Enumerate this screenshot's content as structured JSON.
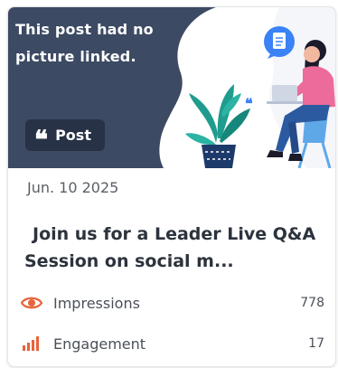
{
  "hero": {
    "message": "This post had no picture linked.",
    "badge_label": "Post",
    "badge_icon": "quote-icon"
  },
  "post": {
    "date": "Jun. 10 2025",
    "title": "Join us for a Leader Live Q&A Session on social m..."
  },
  "metrics": [
    {
      "label": "Impressions",
      "value": "778",
      "icon": "eye-icon",
      "color": "#e8633a"
    },
    {
      "label": "Engagement",
      "value": "17",
      "icon": "bar-chart-icon",
      "color": "#e8633a"
    }
  ],
  "colors": {
    "hero_bg": "#3d4a63",
    "badge_bg": "#283246",
    "accent": "#e8633a",
    "illustration_blue": "#3b82f6",
    "illustration_pink": "#ec6b9a"
  }
}
